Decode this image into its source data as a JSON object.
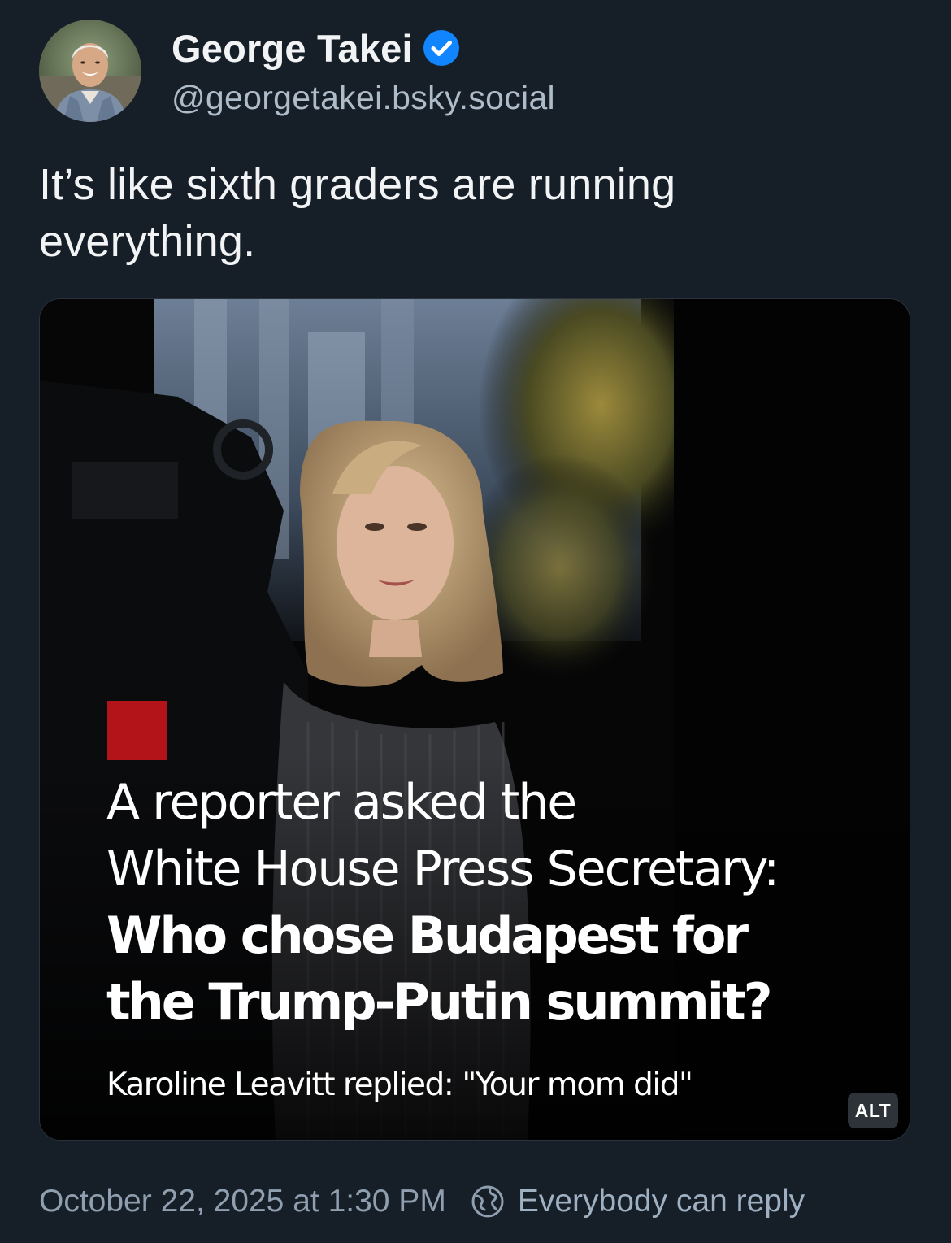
{
  "author": {
    "display_name": "George Takei",
    "handle": "@georgetakei.bsky.social",
    "verified": true
  },
  "post": {
    "text": "It’s like sixth graders are running everything."
  },
  "media": {
    "caption_line1": "A reporter asked the",
    "caption_line2": "White House Press Secretary:",
    "caption_line3": "Who chose Budapest for",
    "caption_line4": "the Trump-Putin summit?",
    "caption_line5": "Karoline Leavitt replied: \"Your mom did\"",
    "alt_label": "ALT"
  },
  "footer": {
    "timestamp": "October 22, 2025 at 1:30 PM",
    "reply_setting": "Everybody can reply"
  },
  "colors": {
    "background": "#161e27",
    "verified_badge": "#1185fe",
    "caption_red": "#b3141a"
  },
  "icons": {
    "verified": "verified-check-icon",
    "reply_setting": "globe-icon"
  }
}
